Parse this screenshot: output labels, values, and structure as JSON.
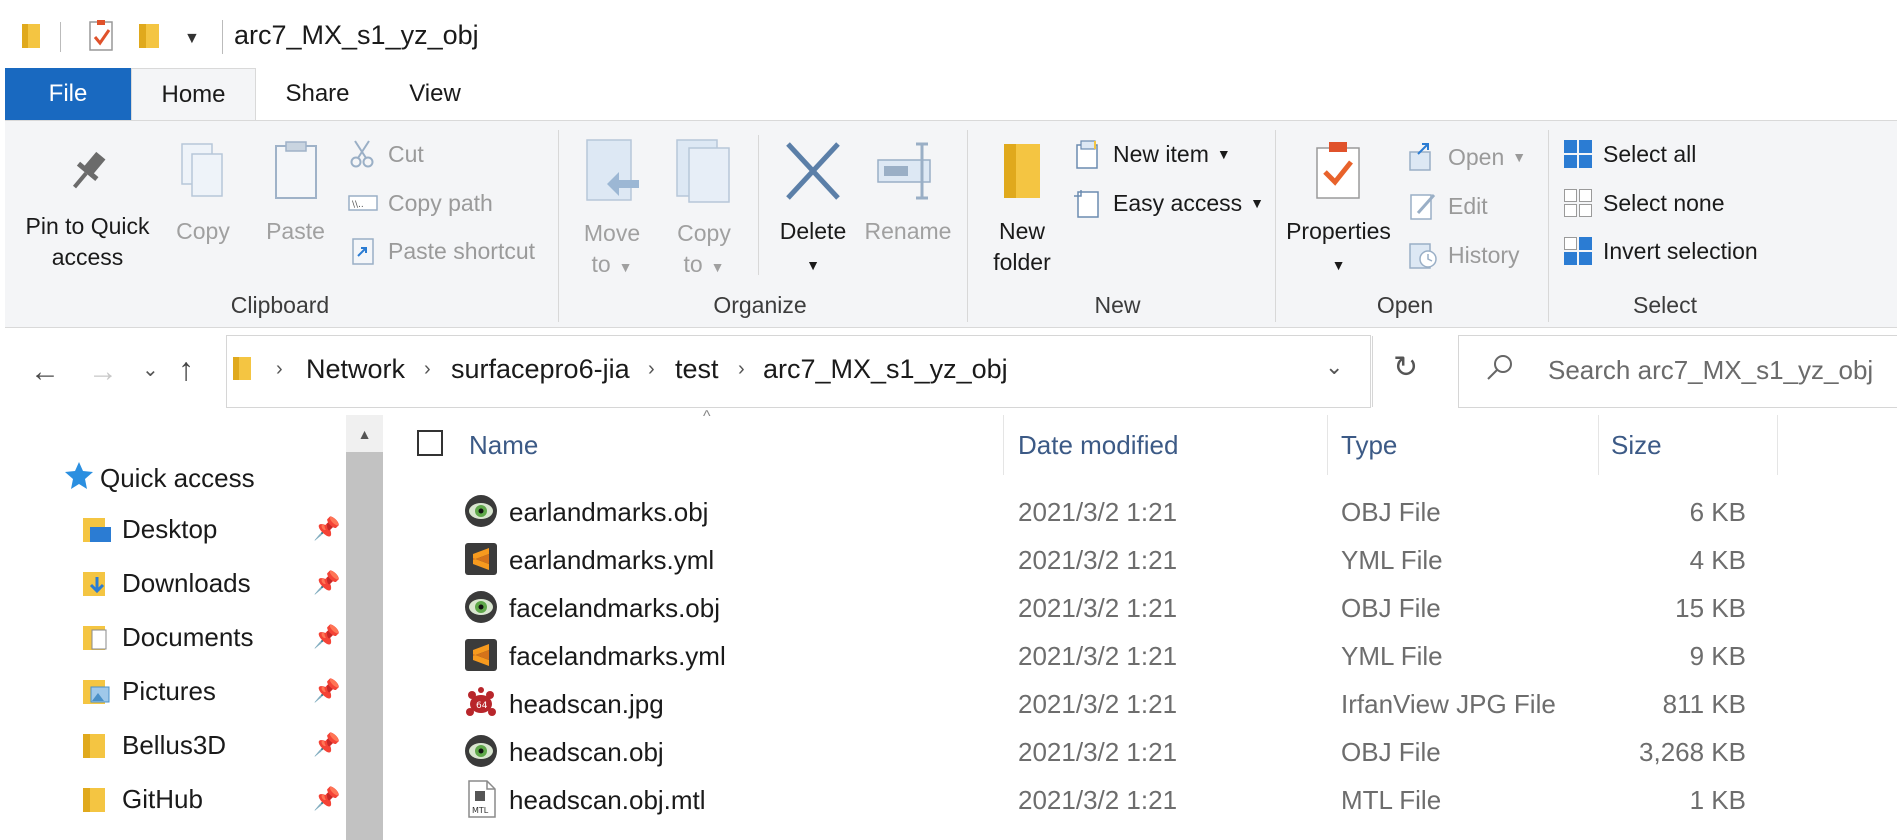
{
  "window": {
    "title": "arc7_MX_s1_yz_obj"
  },
  "ribbon_tabs": [
    {
      "label": "File"
    },
    {
      "label": "Home"
    },
    {
      "label": "Share"
    },
    {
      "label": "View"
    }
  ],
  "ribbon": {
    "clipboard": {
      "label": "Clipboard",
      "pin_line1": "Pin to Quick",
      "pin_line2": "access",
      "copy": "Copy",
      "paste": "Paste",
      "cut": "Cut",
      "copy_path": "Copy path",
      "paste_shortcut": "Paste shortcut"
    },
    "organize": {
      "label": "Organize",
      "move_line1": "Move",
      "move_line2": "to",
      "copy_line1": "Copy",
      "copy_line2": "to",
      "delete": "Delete",
      "rename": "Rename"
    },
    "new": {
      "label": "New",
      "new_folder_line1": "New",
      "new_folder_line2": "folder",
      "new_item": "New item",
      "easy_access": "Easy access"
    },
    "open": {
      "label": "Open",
      "properties": "Properties",
      "open": "Open",
      "edit": "Edit",
      "history": "History"
    },
    "select": {
      "label": "Select",
      "select_all": "Select all",
      "select_none": "Select none",
      "invert_selection": "Invert selection"
    }
  },
  "address": {
    "crumbs": [
      "Network",
      "surfacepro6-jia",
      "test",
      "arc7_MX_s1_yz_obj"
    ],
    "search_placeholder": "Search arc7_MX_s1_yz_obj"
  },
  "navpane": {
    "quick_access": "Quick access",
    "items": [
      {
        "label": "Desktop",
        "folder_color": "#2b7cd3"
      },
      {
        "label": "Downloads",
        "folder_color": "#2b7cd3"
      },
      {
        "label": "Documents",
        "folder_color": "#8a8a8a"
      },
      {
        "label": "Pictures",
        "folder_color": "#4a90c8"
      },
      {
        "label": "Bellus3D",
        "folder_color": "#f4c542"
      },
      {
        "label": "GitHub",
        "folder_color": "#f4c542"
      }
    ]
  },
  "file_list": {
    "columns": [
      "Name",
      "Date modified",
      "Type",
      "Size"
    ],
    "rows": [
      {
        "name": "earlandmarks.obj",
        "date": "2021/3/2 1:21",
        "type": "OBJ File",
        "size": "6 KB",
        "icon": "obj-icon"
      },
      {
        "name": "earlandmarks.yml",
        "date": "2021/3/2 1:21",
        "type": "YML File",
        "size": "4 KB",
        "icon": "sublime-icon"
      },
      {
        "name": "facelandmarks.obj",
        "date": "2021/3/2 1:21",
        "type": "OBJ File",
        "size": "15 KB",
        "icon": "obj-icon"
      },
      {
        "name": "facelandmarks.yml",
        "date": "2021/3/2 1:21",
        "type": "YML File",
        "size": "9 KB",
        "icon": "sublime-icon"
      },
      {
        "name": "headscan.jpg",
        "date": "2021/3/2 1:21",
        "type": "IrfanView JPG File",
        "size": "811 KB",
        "icon": "irfanview-icon"
      },
      {
        "name": "headscan.obj",
        "date": "2021/3/2 1:21",
        "type": "OBJ File",
        "size": "3,268 KB",
        "icon": "obj-icon"
      },
      {
        "name": "headscan.obj.mtl",
        "date": "2021/3/2 1:21",
        "type": "MTL File",
        "size": "1 KB",
        "icon": "mtl-file-icon",
        "icon_text": "MTL"
      }
    ]
  },
  "colors": {
    "accent": "#1969c0",
    "folder": "#f4c542",
    "column_header": "#3c5a86"
  }
}
